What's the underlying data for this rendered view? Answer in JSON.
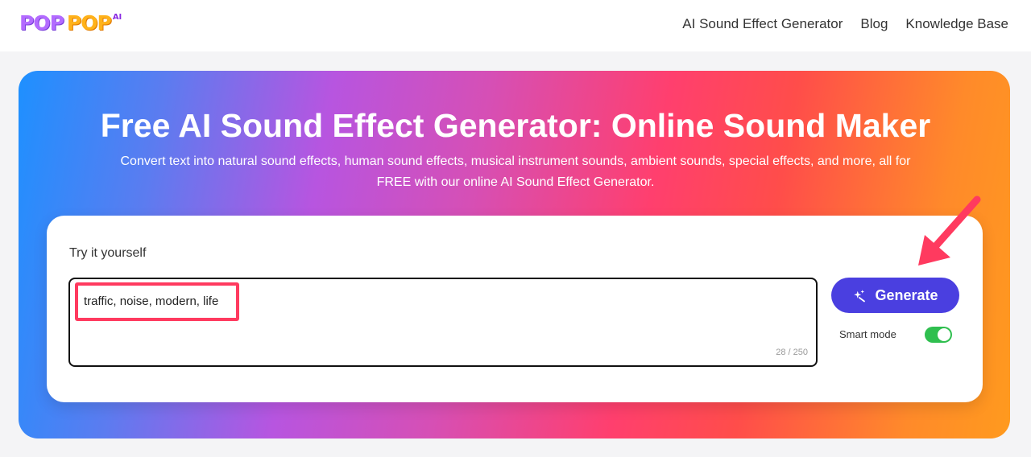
{
  "brand": {
    "logo_pop_1": "POP",
    "logo_pop_2": "POP",
    "logo_ai": "AI"
  },
  "nav": {
    "items": [
      {
        "label": "AI Sound Effect Generator"
      },
      {
        "label": "Blog"
      },
      {
        "label": "Knowledge Base"
      }
    ]
  },
  "hero": {
    "title": "Free AI Sound Effect Generator: Online Sound Maker",
    "subtitle_line1": "Convert text into natural sound effects, human sound effects, musical instrument sounds, ambient sounds, special effects, and more, all for",
    "subtitle_line2": "FREE with our online AI Sound Effect Generator."
  },
  "form": {
    "label": "Try it yourself",
    "prompt_value": "traffic, noise, modern, life",
    "char_count": "28 / 250",
    "generate_label": "Generate",
    "smart_mode_label": "Smart mode",
    "smart_mode_on": true
  },
  "colors": {
    "generate_button": "#4a3fe0",
    "toggle_on": "#2fbf4f",
    "annotation_red": "#ff3a5f"
  },
  "icons": {
    "generate": "sparkle-icon",
    "annotation": "arrow-icon"
  }
}
